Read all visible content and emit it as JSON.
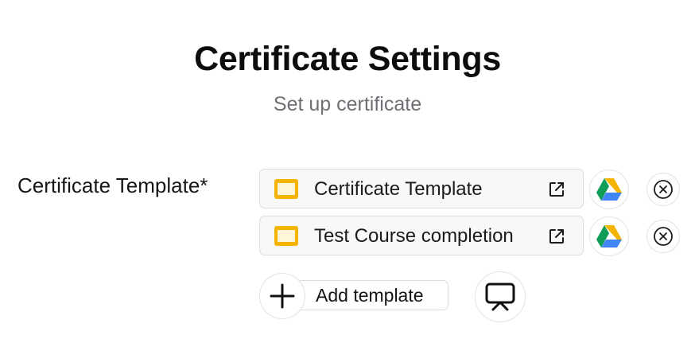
{
  "header": {
    "title": "Certificate Settings",
    "subtitle": "Set up certificate"
  },
  "certificate_template": {
    "label": "Certificate Template*",
    "templates": [
      {
        "name": "Certificate Template",
        "icon": "slides-icon"
      },
      {
        "name": "Test Course completion",
        "icon": "slides-icon"
      }
    ],
    "row_actions": {
      "open_icon": "external-link-icon",
      "drive_icon": "google-drive-icon",
      "remove_icon": "close-circle-icon"
    },
    "add_template_label": "Add template",
    "add_icon": "plus-icon",
    "present_icon": "presentation-icon"
  },
  "colors": {
    "slides_yellow": "#F4B400",
    "drive_green": "#0F9D58",
    "drive_yellow": "#F4B400",
    "drive_blue": "#4285F4",
    "subtitle_gray": "#6f7075"
  }
}
